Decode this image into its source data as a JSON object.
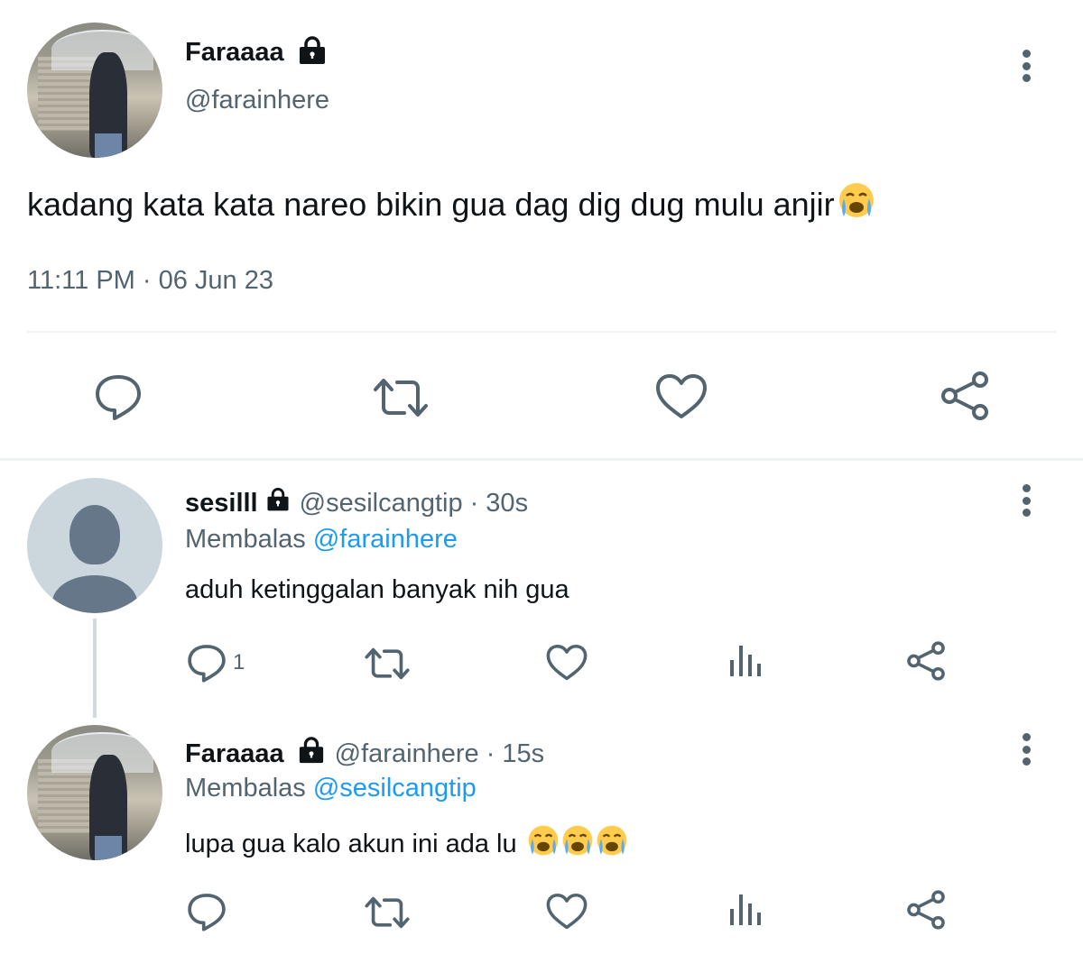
{
  "main_tweet": {
    "display_name": "Faraaaa",
    "handle": "@farainhere",
    "text": "kadang kata kata nareo bikin gua dag dig dug mulu anjir",
    "timestamp": "11:11 PM · 06 Jun 23",
    "icons": [
      "lock-icon",
      "more-icon",
      "reply-icon",
      "retweet-icon",
      "like-icon",
      "share-icon"
    ]
  },
  "replies": [
    {
      "display_name": "sesilll",
      "handle": "@sesilcangtip",
      "time": "· 30s",
      "replying_prefix": "Membalas",
      "replying_to": "@farainhere",
      "text": "aduh ketinggalan banyak nih gua",
      "reply_count": "1"
    },
    {
      "display_name": "Faraaaa",
      "handle": "@farainhere",
      "time": "· 15s",
      "replying_prefix": "Membalas",
      "replying_to": "@sesilcangtip",
      "text": "lupa gua kalo akun ini ada lu",
      "reply_count": ""
    }
  ],
  "colors": {
    "text": "#0f1419",
    "muted": "#536471",
    "link": "#1d9bf0",
    "divider": "#eff3f4"
  }
}
